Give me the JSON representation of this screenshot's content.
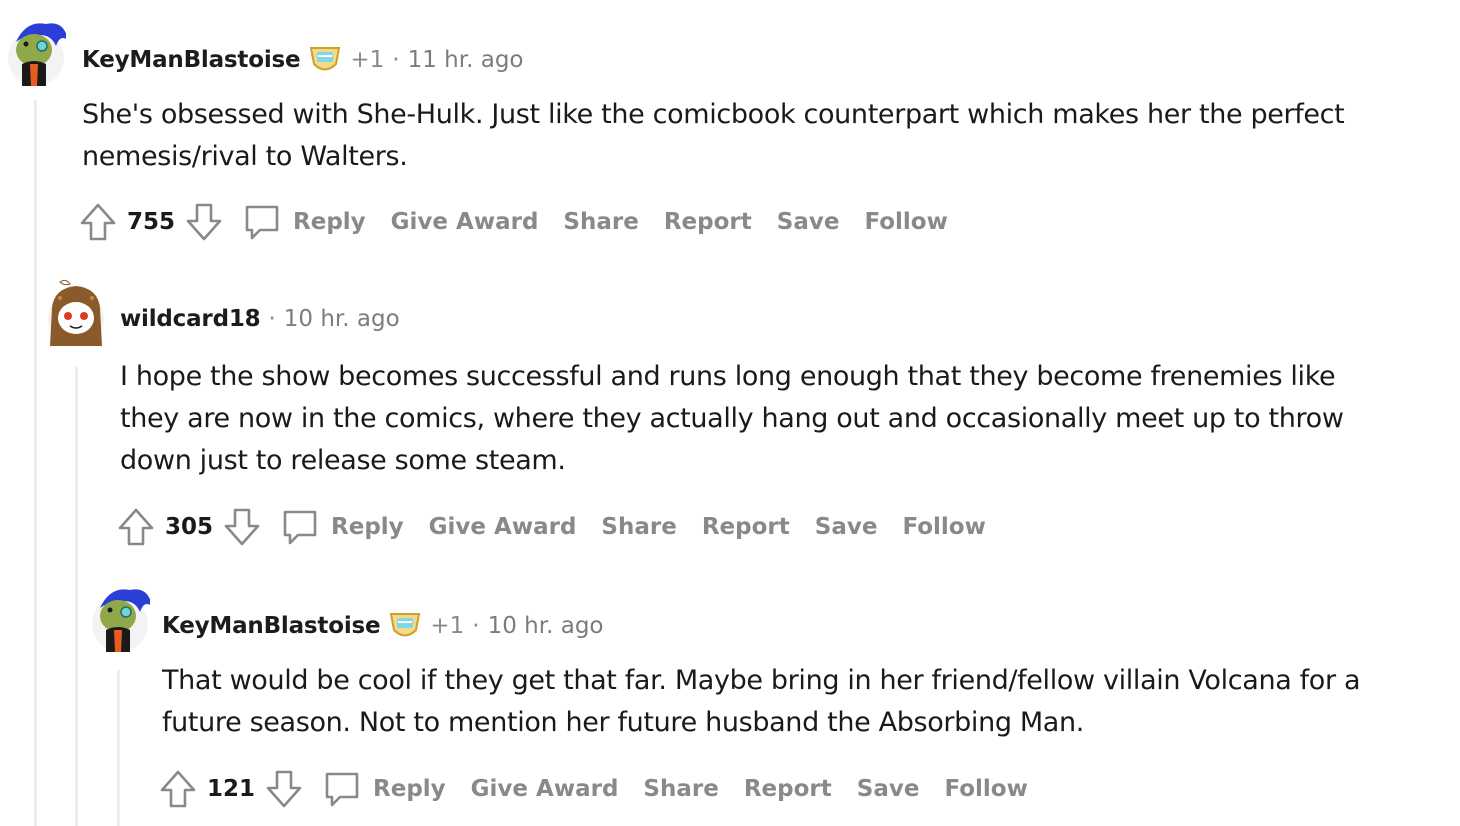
{
  "comments": [
    {
      "username": "KeyManBlastoise",
      "flair_icon": "trophy-award-icon",
      "plus": "+1",
      "time": "11 hr. ago",
      "body": "She's obsessed with She-Hulk. Just like the comicbook counterpart which makes her the perfect\nnemesis/rival to Walters.",
      "score": "755",
      "avatar_icon": "frog-avatar-icon",
      "actions": {
        "reply": "Reply",
        "award": "Give Award",
        "share": "Share",
        "report": "Report",
        "save": "Save",
        "follow": "Follow"
      }
    },
    {
      "username": "wildcard18",
      "time": "10 hr. ago",
      "body": "I hope the show becomes successful and runs long enough that they become frenemies like\nthey are now in the comics, where they actually hang out and occasionally meet up to throw\ndown just to release some steam.",
      "score": "305",
      "avatar_icon": "owl-hood-avatar-icon",
      "actions": {
        "reply": "Reply",
        "award": "Give Award",
        "share": "Share",
        "report": "Report",
        "save": "Save",
        "follow": "Follow"
      }
    },
    {
      "username": "KeyManBlastoise",
      "flair_icon": "trophy-award-icon",
      "plus": "+1",
      "time": "10 hr. ago",
      "body": "That would be cool if they get that far. Maybe bring in her friend/fellow villain Volcana for a\nfuture season. Not to mention her future husband the Absorbing Man.",
      "score": "121",
      "avatar_icon": "frog-avatar-icon",
      "actions": {
        "reply": "Reply",
        "award": "Give Award",
        "share": "Share",
        "report": "Report",
        "save": "Save",
        "follow": "Follow"
      }
    }
  ],
  "separator": "·",
  "colors": {
    "meta": "#878a8c",
    "thread_line": "#ededed",
    "text": "#1a1a1b"
  }
}
